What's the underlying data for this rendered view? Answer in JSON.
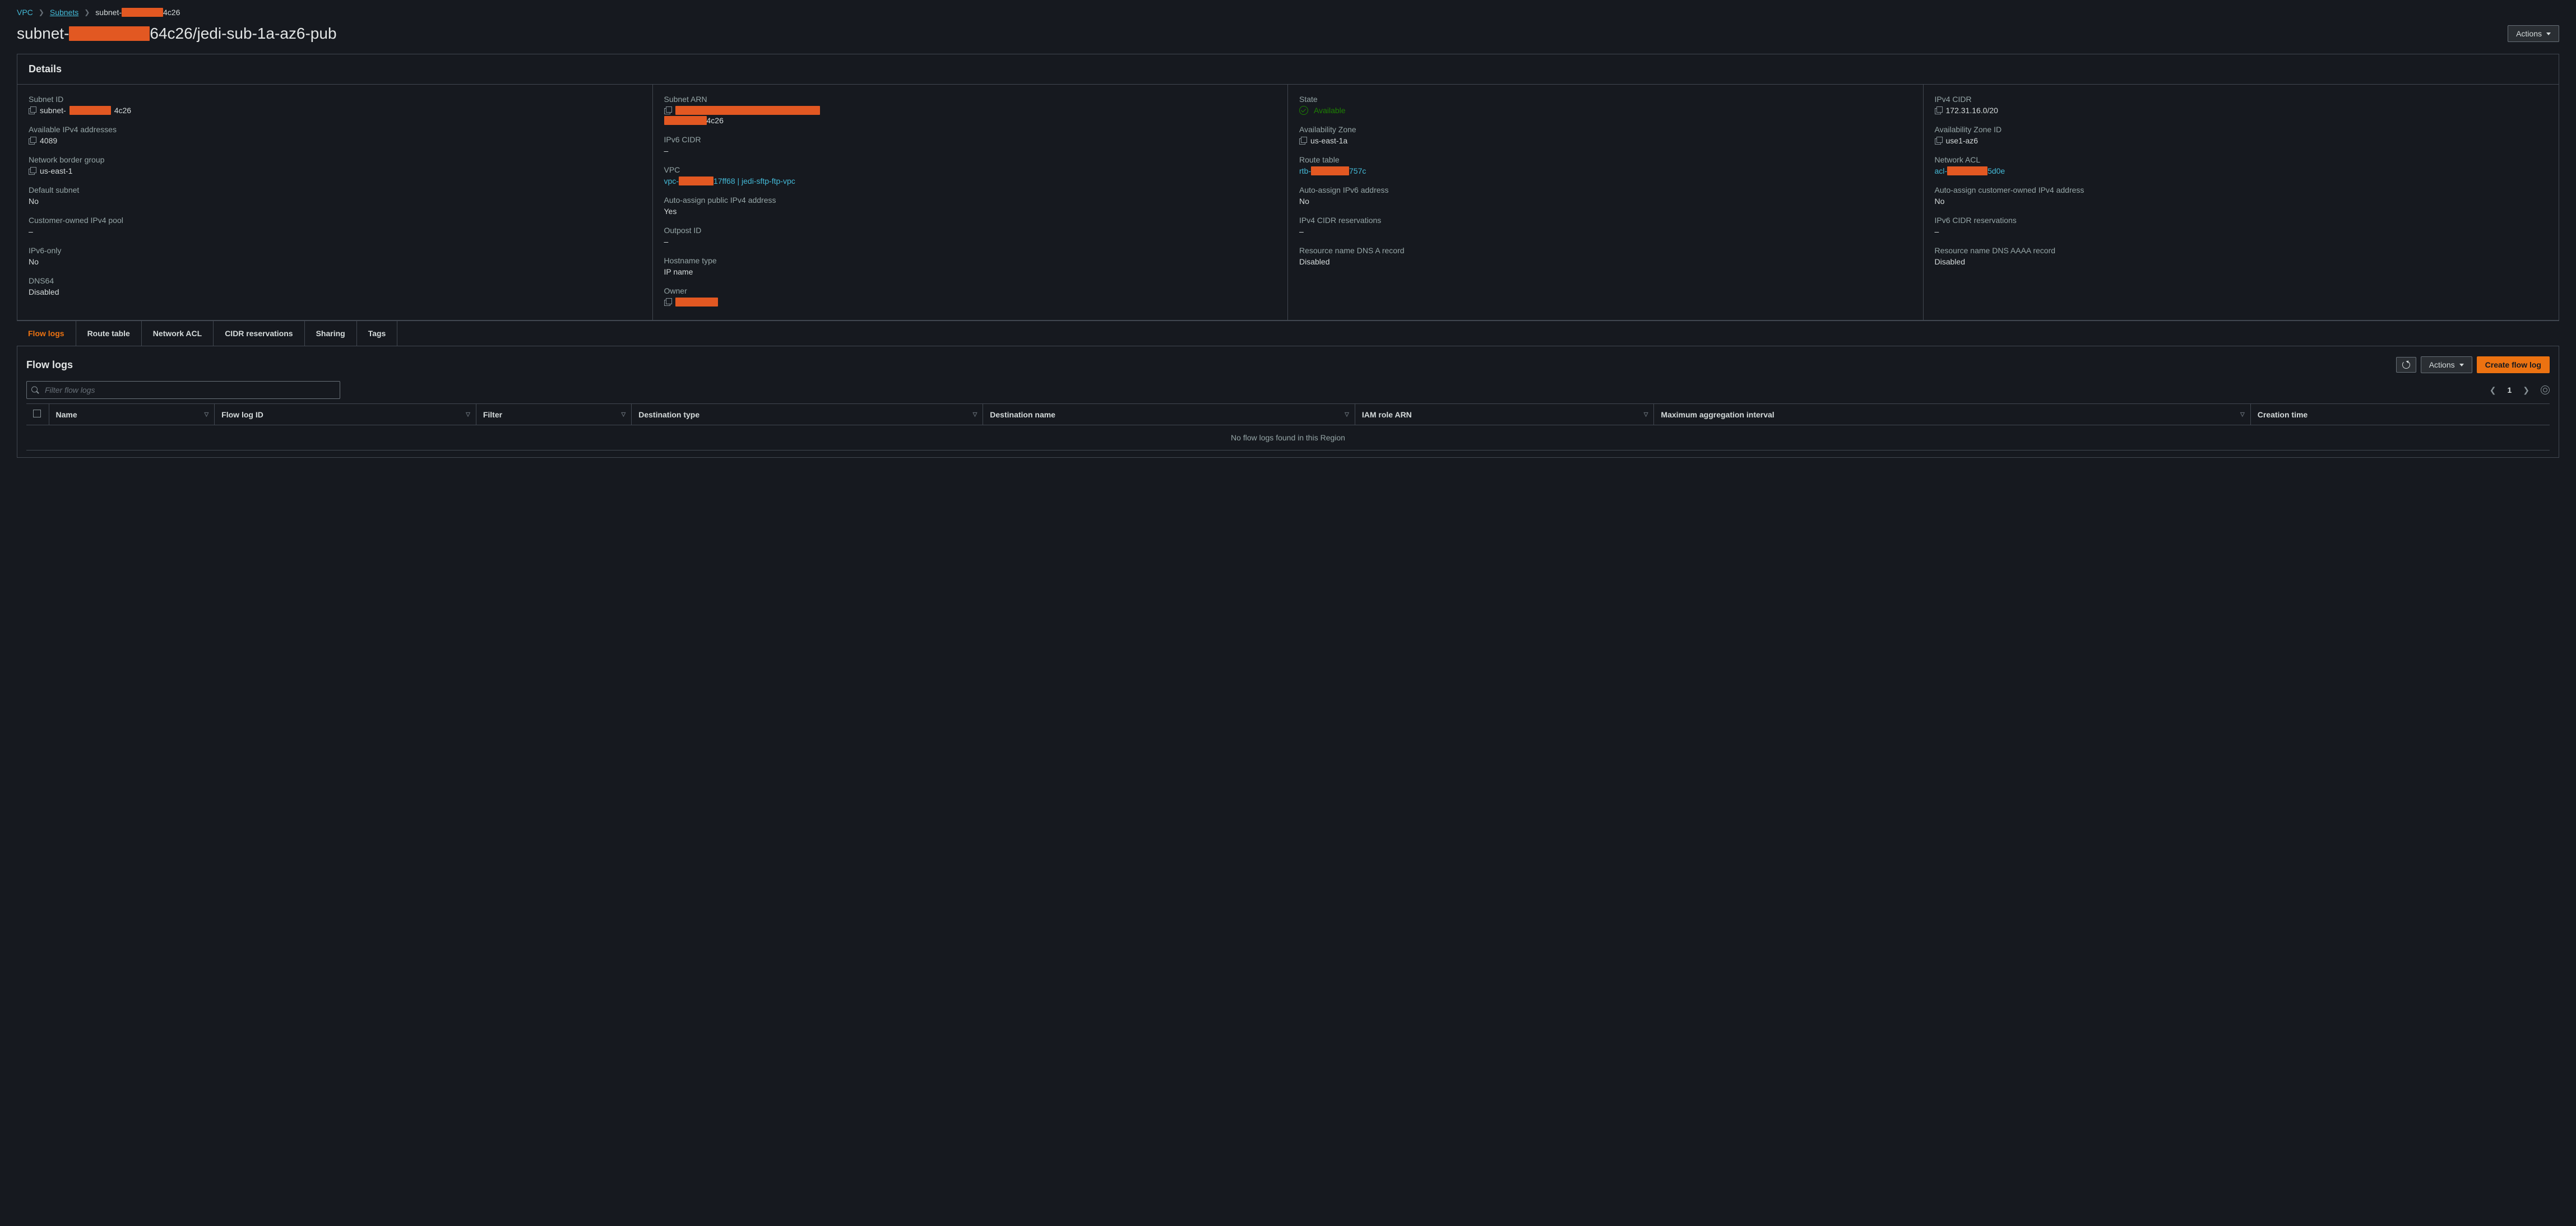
{
  "breadcrumb": {
    "root": "VPC",
    "level2": "Subnets",
    "current_prefix": "subnet-",
    "current_suffix": "4c26"
  },
  "title": {
    "prefix": "subnet-",
    "mid_suffix": "64c26",
    "separator": " / ",
    "name": "jedi-sub-1a-az6-pub"
  },
  "actions_label": "Actions",
  "details": {
    "heading": "Details",
    "col1": {
      "subnet_id": {
        "label": "Subnet ID",
        "prefix": "subnet-",
        "suffix": "4c26"
      },
      "avail_ipv4": {
        "label": "Available IPv4 addresses",
        "value": "4089"
      },
      "nbg": {
        "label": "Network border group",
        "value": "us-east-1"
      },
      "default_subnet": {
        "label": "Default subnet",
        "value": "No"
      },
      "co_ipv4_pool": {
        "label": "Customer-owned IPv4 pool",
        "value": "–"
      },
      "ipv6_only": {
        "label": "IPv6-only",
        "value": "No"
      },
      "dns64": {
        "label": "DNS64",
        "value": "Disabled"
      }
    },
    "col2": {
      "subnet_arn": {
        "label": "Subnet ARN",
        "suffix": "4c26"
      },
      "ipv6_cidr": {
        "label": "IPv6 CIDR",
        "value": "–"
      },
      "vpc": {
        "label": "VPC",
        "prefix": "vpc-",
        "suffix": "17ff68 | jedi-sftp-ftp-vpc"
      },
      "auto_pub_ipv4": {
        "label": "Auto-assign public IPv4 address",
        "value": "Yes"
      },
      "outpost_id": {
        "label": "Outpost ID",
        "value": "–"
      },
      "hostname_type": {
        "label": "Hostname type",
        "value": "IP name"
      },
      "owner": {
        "label": "Owner"
      }
    },
    "col3": {
      "state": {
        "label": "State",
        "value": "Available"
      },
      "az": {
        "label": "Availability Zone",
        "value": "us-east-1a"
      },
      "route_table": {
        "label": "Route table",
        "prefix": "rtb-",
        "suffix": "757c"
      },
      "auto_ipv6": {
        "label": "Auto-assign IPv6 address",
        "value": "No"
      },
      "ipv4_cidr_res": {
        "label": "IPv4 CIDR reservations",
        "value": "–"
      },
      "dns_a": {
        "label": "Resource name DNS A record",
        "value": "Disabled"
      }
    },
    "col4": {
      "ipv4_cidr": {
        "label": "IPv4 CIDR",
        "value": "172.31.16.0/20"
      },
      "az_id": {
        "label": "Availability Zone ID",
        "value": "use1-az6"
      },
      "nacl": {
        "label": "Network ACL",
        "prefix": "acl-",
        "suffix": "5d0e"
      },
      "auto_co_ipv4": {
        "label": "Auto-assign customer-owned IPv4 address",
        "value": "No"
      },
      "ipv6_cidr_res": {
        "label": "IPv6 CIDR reservations",
        "value": "–"
      },
      "dns_aaaa": {
        "label": "Resource name DNS AAAA record",
        "value": "Disabled"
      }
    }
  },
  "tabs": {
    "flow_logs": "Flow logs",
    "route_table": "Route table",
    "nacl": "Network ACL",
    "cidr_res": "CIDR reservations",
    "sharing": "Sharing",
    "tags": "Tags"
  },
  "flow_logs": {
    "heading": "Flow logs",
    "refresh_title": "Refresh",
    "actions": "Actions",
    "create": "Create flow log",
    "filter_placeholder": "Filter flow logs",
    "page": "1",
    "columns": {
      "name": "Name",
      "flow_log_id": "Flow log ID",
      "filter": "Filter",
      "dest_type": "Destination type",
      "dest_name": "Destination name",
      "iam_role": "IAM role ARN",
      "max_agg": "Maximum aggregation interval",
      "creation": "Creation time"
    },
    "empty": "No flow logs found in this Region"
  }
}
